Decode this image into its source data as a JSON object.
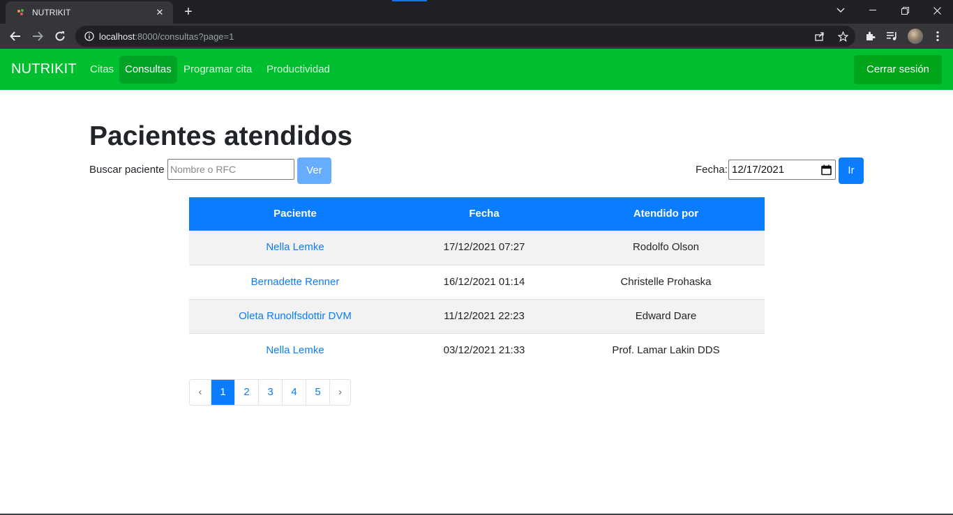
{
  "browser": {
    "tab_title": "NUTRIKIT",
    "tab_close": "✕",
    "new_tab": "+",
    "url_host": "localhost",
    "url_rest": ":8000/consultas?page=1"
  },
  "navbar": {
    "brand": "NUTRIKIT",
    "links": [
      {
        "label": "Citas",
        "active": false
      },
      {
        "label": "Consultas",
        "active": true
      },
      {
        "label": "Programar cita",
        "active": false
      },
      {
        "label": "Productividad",
        "active": false
      }
    ],
    "logout_label": "Cerrar sesión",
    "bg_color": "#00bf2e"
  },
  "main": {
    "title": "Pacientes atendidos",
    "search_label": "Buscar paciente",
    "search_placeholder": "Nombre o RFC",
    "search_value": "",
    "search_button": "Ver",
    "date_label": "Fecha:",
    "date_value": "12/17/2021",
    "date_button": "Ir"
  },
  "table": {
    "headers": [
      "Paciente",
      "Fecha",
      "Atendido por"
    ],
    "rows": [
      {
        "patient": "Nella Lemke",
        "date": "17/12/2021 07:27",
        "attended_by": "Rodolfo Olson"
      },
      {
        "patient": "Bernadette Renner",
        "date": "16/12/2021 01:14",
        "attended_by": "Christelle Prohaska"
      },
      {
        "patient": "Oleta Runolfsdottir DVM",
        "date": "11/12/2021 22:23",
        "attended_by": "Edward Dare"
      },
      {
        "patient": "Nella Lemke",
        "date": "03/12/2021 21:33",
        "attended_by": "Prof. Lamar Lakin DDS"
      }
    ]
  },
  "pagination": {
    "prev": "‹",
    "pages": [
      "1",
      "2",
      "3",
      "4",
      "5"
    ],
    "current": "1",
    "next": "›"
  },
  "colors": {
    "primary": "#0a7cff",
    "nav_green": "#00bf2e",
    "logout_green": "#00a51a"
  }
}
